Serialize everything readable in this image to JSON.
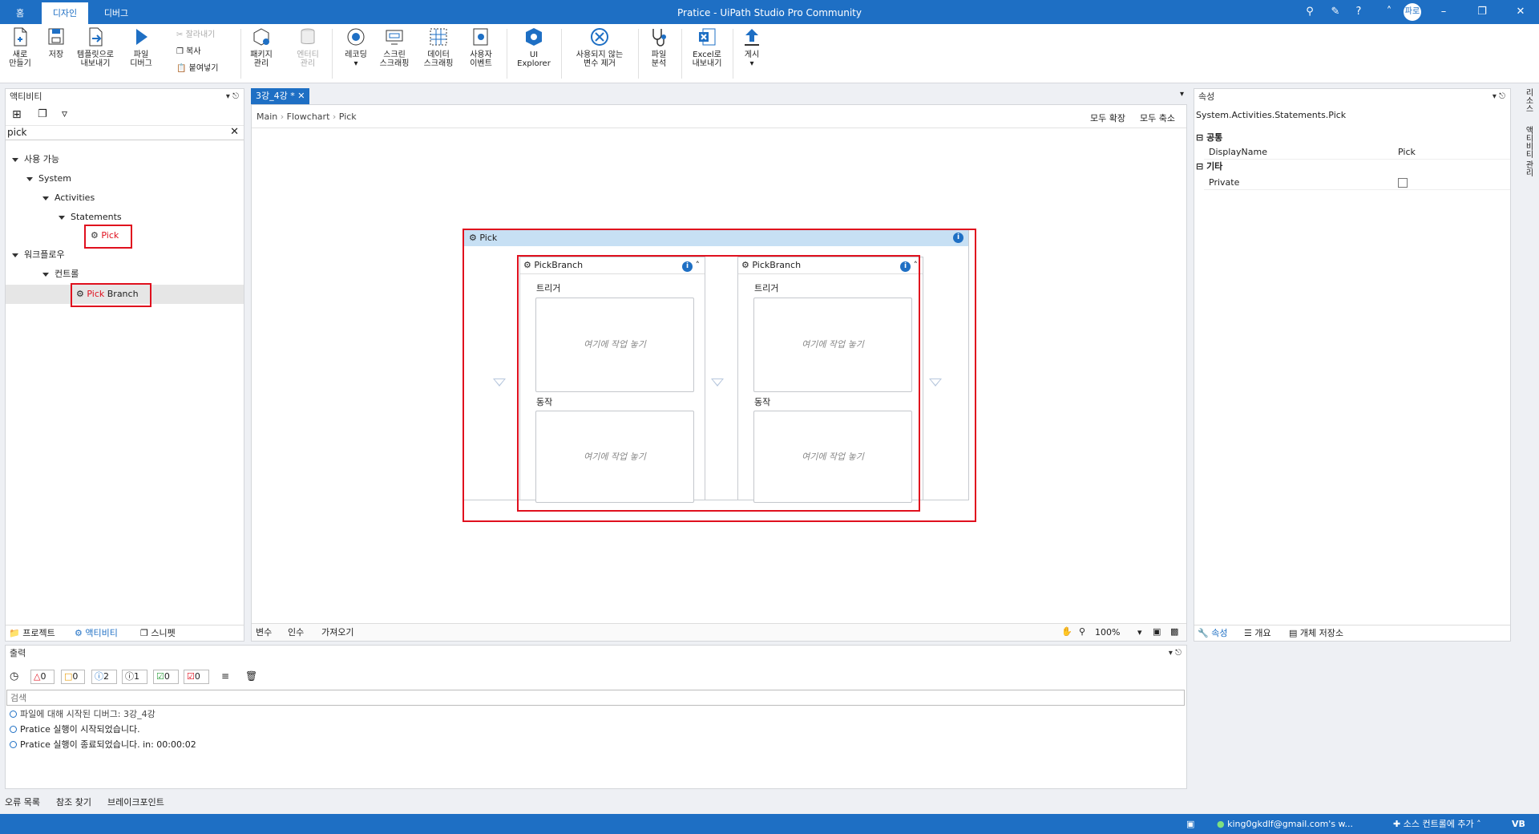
{
  "window": {
    "title": "Pratice - UiPath Studio Pro Community",
    "home": "홈",
    "tabs": [
      "디자인",
      "디버그"
    ],
    "user": "파로"
  },
  "ribbon": {
    "new": "새로\n만들기",
    "save": "저장",
    "export_template": "템플릿으로\n내보내기",
    "debug_file": "파일\n디버그",
    "cut": "잘라내기",
    "copy": "복사",
    "paste": "붙여넣기",
    "manage_packages": "패키지\n관리",
    "manage_entities": "엔터티\n관리",
    "recording": "레코딩",
    "screen_scraping": "스크린\n스크래핑",
    "data_scraping": "데이터\n스크래핑",
    "user_events": "사용자\n이벤트",
    "ui_explorer": "UI\nExplorer",
    "remove_unused": "사용되지 않는\n변수 제거",
    "analyze_file": "파일\n분석",
    "export_excel": "Excel로\n내보내기",
    "publish": "게시"
  },
  "activities": {
    "title": "액티비티",
    "search_value": "pick",
    "tree": {
      "available": "사용 가능",
      "system": "System",
      "activities": "Activities",
      "statements": "Statements",
      "pick_label": "Pick",
      "workflow": "워크플로우",
      "control": "컨트롤",
      "pickbranch_prefix": "Pick",
      "pickbranch_suffix": " Branch"
    },
    "bottom_tabs": [
      "프로젝트",
      "액티비티",
      "스니펫"
    ]
  },
  "designer": {
    "tab": "3강_4강 *",
    "breadcrumb": [
      "Main",
      "Flowchart",
      "Pick"
    ],
    "expand_all": "모두 확장",
    "collapse_all": "모두 축소",
    "pick_title": "Pick",
    "branches": [
      {
        "title": "PickBranch",
        "trigger_label": "트리거",
        "action_label": "동작",
        "drop_hint": "여기에 작업 놓기"
      },
      {
        "title": "PickBranch",
        "trigger_label": "트리거",
        "action_label": "동작",
        "drop_hint": "여기에 작업 놓기"
      }
    ],
    "bottom_tabs": [
      "변수",
      "인수",
      "가져오기"
    ],
    "zoom": "100%"
  },
  "properties": {
    "title": "속성",
    "type": "System.Activities.Statements.Pick",
    "cat_common": "공통",
    "display_name_key": "DisplayName",
    "display_name_value": "Pick",
    "cat_misc": "기타",
    "private_key": "Private",
    "bottom_tabs": [
      "속성",
      "개요",
      "개체 저장소"
    ],
    "side_tabs": [
      "리소스",
      "액티비티 관리"
    ]
  },
  "output": {
    "title": "출력",
    "filters": {
      "error": "0",
      "warning": "0",
      "info": "2",
      "trace": "1",
      "success": "0",
      "fail": "0"
    },
    "search_placeholder": "검색",
    "lines": [
      "파일에 대해 시작된 디버그: 3강_4강",
      "Pratice 실행이 시작되었습니다.",
      "Pratice 실행이 종료되었습니다. in: 00:00:02"
    ],
    "bottom_tabs": [
      "오류 목록",
      "참조 찾기",
      "브레이크포인트"
    ]
  },
  "statusbar": {
    "account": "king0gkdlf@gmail.com's w...",
    "source_control": "소스 컨트롤에 추가",
    "language": "VB"
  },
  "colors": {
    "accent": "#1e6fc4",
    "highlight_red": "#e0101e"
  }
}
